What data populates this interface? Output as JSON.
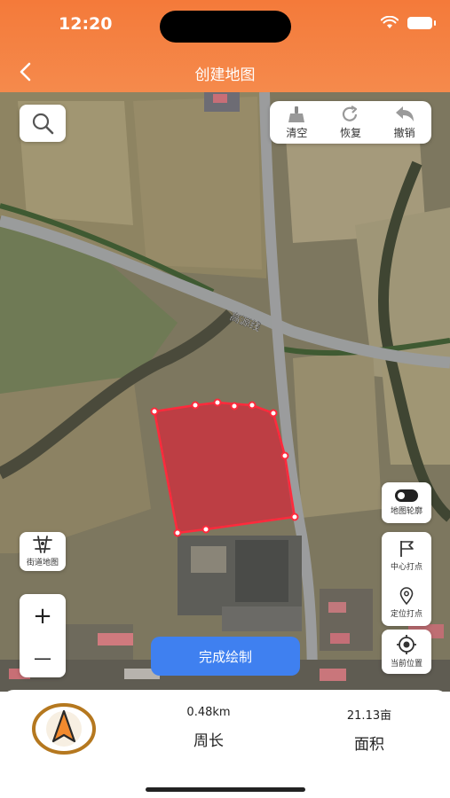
{
  "status_bar": {
    "time": "12:20"
  },
  "header": {
    "title": "创建地图",
    "back_icon": "chevron-left-icon"
  },
  "toolbar": {
    "clear_label": "清空",
    "restore_label": "恢复",
    "undo_label": "撤销"
  },
  "map": {
    "road_label": "高源线",
    "polygon_fill": "#d5283a",
    "polygon_stroke": "#ff2a3c"
  },
  "controls": {
    "outline_label": "地图轮廓",
    "street_map_label": "街道地图",
    "center_pin_label": "中心打点",
    "locate_pin_label": "定位打点",
    "current_location_label": "当前位置",
    "zoom_in": "+",
    "zoom_out": "—",
    "finish_label": "完成绘制"
  },
  "stats": {
    "perimeter_value": "0.48km",
    "perimeter_label": "周长",
    "area_value": "21.13亩",
    "area_label": "面积"
  },
  "colors": {
    "header": "#f47a3a",
    "primary_button": "#3f80f0",
    "compass_ring": "#b5781f",
    "compass_arrow": "#f28a2e"
  }
}
